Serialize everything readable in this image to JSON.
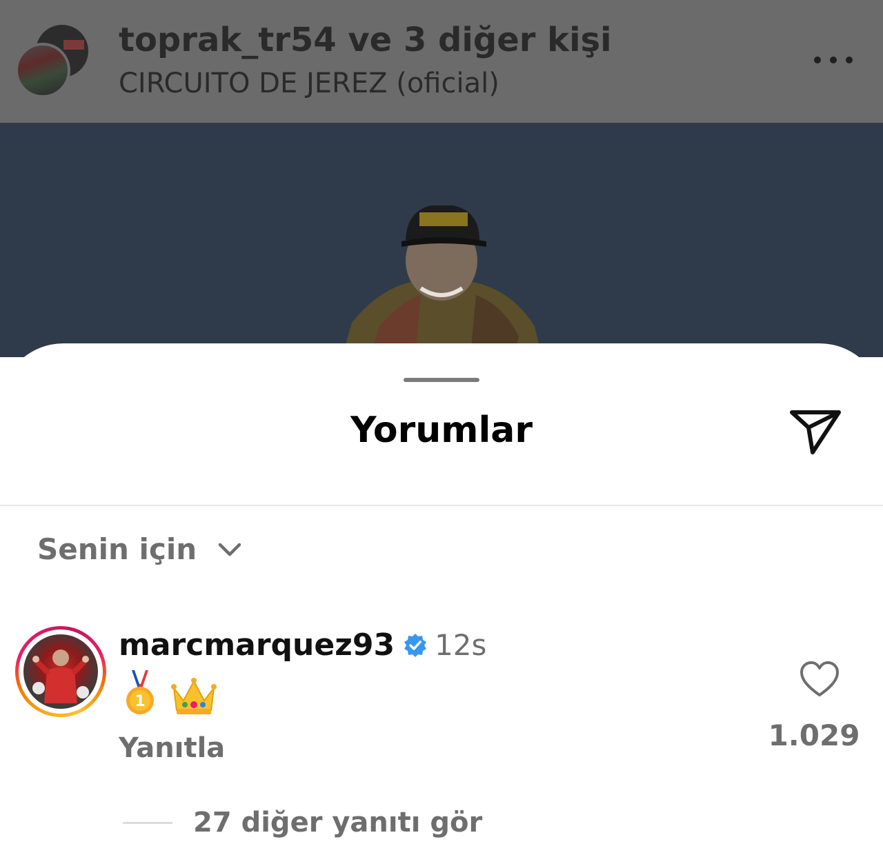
{
  "post": {
    "title": "toprak_tr54 ve 3 diğer kişi",
    "subtitle": "CIRCUITO DE JEREZ (oficial)",
    "more_icon": "more-horizontal-icon"
  },
  "sheet": {
    "title": "Yorumlar",
    "share_icon": "paper-plane-icon",
    "filter_label": "Senin için",
    "filter_icon": "chevron-down-icon"
  },
  "comment": {
    "username": "marcmarquez93",
    "verified": true,
    "time": "12s",
    "text_icons": [
      "first-place-medal-icon",
      "crown-icon"
    ],
    "reply_label": "Yanıtla",
    "like_count": "1.029",
    "view_replies": "27 diğer yanıtı gör"
  },
  "colors": {
    "dim_overlay": "#6b6b6b",
    "muted_text": "#6e6e6e",
    "verified_blue": "#3897f0"
  }
}
